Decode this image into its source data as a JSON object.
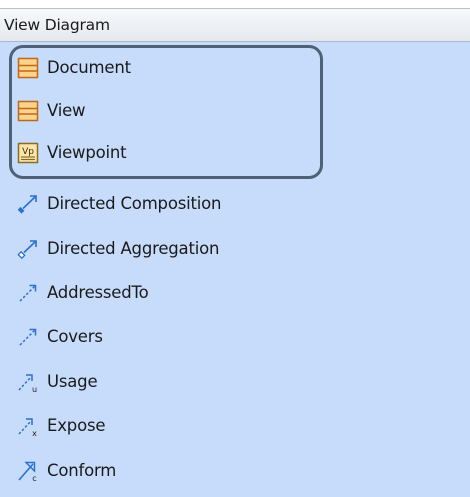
{
  "palette": {
    "title": "View Diagram",
    "items": [
      {
        "label": "Document",
        "icon": "document-shape-icon"
      },
      {
        "label": "View",
        "icon": "view-shape-icon"
      },
      {
        "label": "Viewpoint",
        "icon": "viewpoint-shape-icon",
        "icon_text": "Vp"
      },
      {
        "label": "Directed Composition",
        "icon": "directed-composition-icon"
      },
      {
        "label": "Directed Aggregation",
        "icon": "directed-aggregation-icon"
      },
      {
        "label": "AddressedTo",
        "icon": "dependency-arrow-icon"
      },
      {
        "label": "Covers",
        "icon": "dependency-arrow-icon"
      },
      {
        "label": "Usage",
        "icon": "usage-arrow-icon",
        "icon_text": "u"
      },
      {
        "label": "Expose",
        "icon": "expose-arrow-icon",
        "icon_text": "x"
      },
      {
        "label": "Conform",
        "icon": "conform-arrow-icon",
        "icon_text": "c"
      }
    ]
  },
  "colors": {
    "palette_background": "#c7dcfb",
    "header_background": "#eef1f5",
    "highlight_border": "#4e6175",
    "shape_icon_fill": "#fbd48a",
    "shape_icon_border": "#c0671b",
    "arrow_icon_color": "#2b6fd0"
  }
}
